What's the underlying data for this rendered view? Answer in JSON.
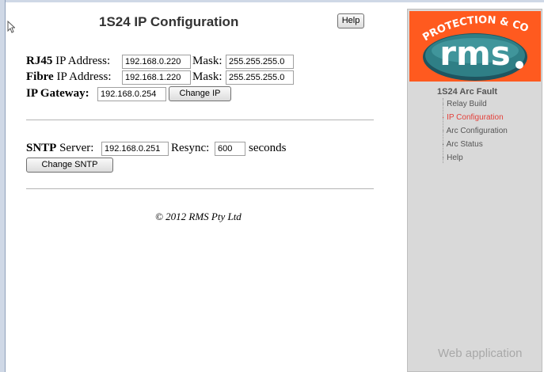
{
  "page": {
    "title": "1S24 IP Configuration",
    "help_label": "Help"
  },
  "ip": {
    "rj45_label_bold": "RJ45",
    "rj45_label_rest": " IP Address:",
    "rj45_ip": "192.168.0.220",
    "mask_label": "Mask:",
    "rj45_mask": "255.255.255.0",
    "fibre_label_bold": "Fibre",
    "fibre_label_rest": " IP Address:",
    "fibre_ip": "192.168.1.220",
    "fibre_mask": "255.255.255.0",
    "gateway_label": "IP Gateway:",
    "gateway": "192.168.0.254",
    "change_ip_label": "Change IP"
  },
  "sntp": {
    "label_bold": "SNTP",
    "label_rest": " Server:",
    "server": "192.168.0.251",
    "resync_label": "Resync:",
    "resync": "600",
    "seconds_label": "seconds",
    "change_label": "Change SNTP"
  },
  "footer": {
    "copyright": "© 2012 RMS Pty Ltd"
  },
  "sidebar": {
    "logo_arc_text": "PROTECTION & CONTROL",
    "logo_text": "rms",
    "section_title": "1S24 Arc Fault",
    "items": [
      {
        "label": "Relay Build"
      },
      {
        "label": "IP Configuration"
      },
      {
        "label": "Arc Configuration"
      },
      {
        "label": "Arc Status"
      },
      {
        "label": "Help"
      }
    ],
    "footer": "Web application"
  },
  "colors": {
    "logo_orange": "#ff5a1f",
    "logo_teal": "#2f7f86",
    "active_link": "#e4403a"
  }
}
